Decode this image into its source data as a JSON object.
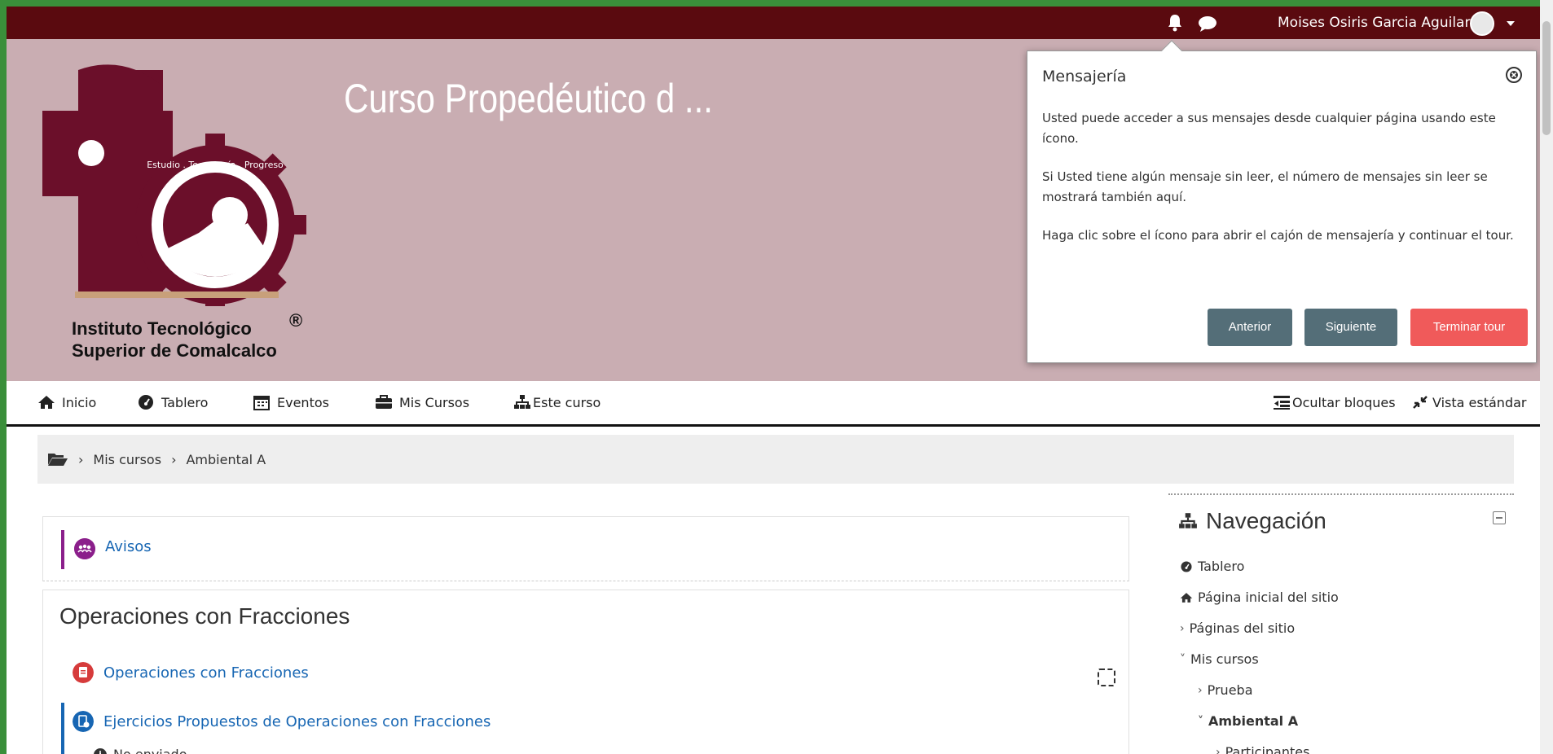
{
  "topbar": {
    "user_name": "Moises Osiris Garcia Aguilar",
    "icons": [
      "bell-icon",
      "chat-icon",
      "avatar",
      "caret-down-icon"
    ]
  },
  "header": {
    "course_title": "Curso Propedéutico d ...",
    "logo_line1": "Instituto Tecnológico",
    "logo_reg": "®",
    "logo_line2": "Superior de Comalcalco",
    "logo_ring_text": "Estudio . Tecnología . Progreso",
    "colors": {
      "bar": "#5a0a0f",
      "banner": "#c9adb2",
      "logo": "#6b0f2a"
    }
  },
  "tour": {
    "title": "Mensajería",
    "paragraphs": [
      "Usted puede acceder a sus mensajes desde cualquier página usando este ícono.",
      "Si Usted tiene algún mensaje sin leer, el número de mensajes sin leer se mostrará también aquí.",
      "Haga clic sobre el ícono para abrir el cajón de mensajería y continuar el tour."
    ],
    "buttons": {
      "prev": "Anterior",
      "next": "Siguiente",
      "end": "Terminar tour"
    }
  },
  "navbar": {
    "items": [
      "Inicio",
      "Tablero",
      "Eventos",
      "Mis Cursos",
      "Este curso"
    ],
    "right": {
      "hide_blocks": "Ocultar bloques",
      "standard_view": "Vista estándar"
    }
  },
  "breadcrumb": {
    "items": [
      "Mis cursos",
      "Ambiental A"
    ]
  },
  "main": {
    "announcements": "Avisos",
    "section_title": "Operaciones con Fracciones",
    "activities": [
      {
        "label": "Operaciones con Fracciones",
        "icon": "pdf-icon"
      },
      {
        "label": "Ejercicios Propuestos de Operaciones con Fracciones",
        "icon": "assignment-icon"
      }
    ],
    "status": "No enviado"
  },
  "nav_block": {
    "title": "Navegación",
    "items": [
      "Tablero",
      "Página inicial del sitio",
      "Páginas del sitio",
      "Mis cursos",
      "Prueba",
      "Ambiental A",
      "Participantes"
    ]
  }
}
